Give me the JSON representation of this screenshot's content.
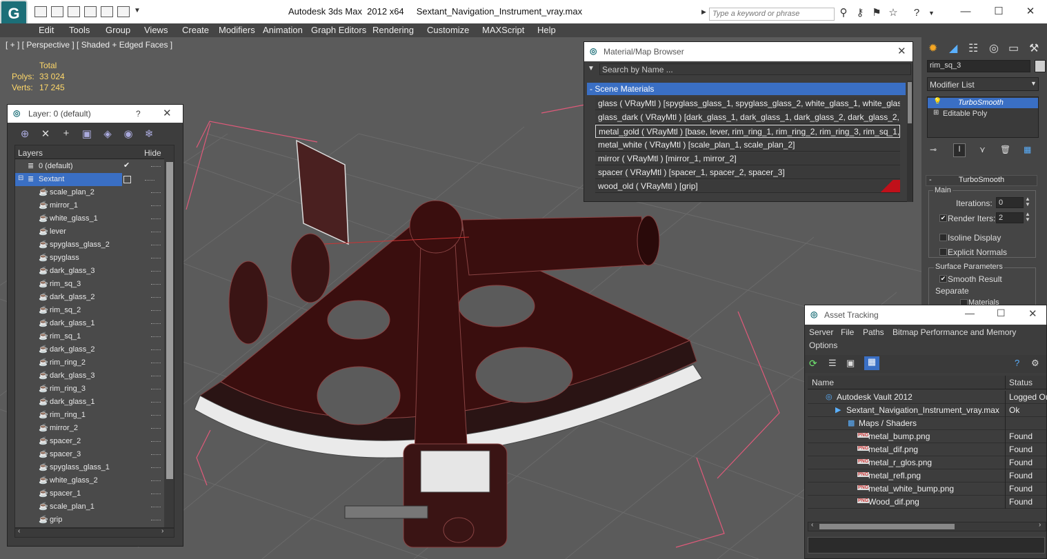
{
  "app": {
    "title": "Autodesk 3ds Max  2012 x64     Sextant_Navigation_Instrument_vray.max",
    "search_placeholder": "Type a keyword or phrase"
  },
  "menu": [
    "Edit",
    "Tools",
    "Group",
    "Views",
    "Create",
    "Modifiers",
    "Animation",
    "Graph Editors",
    "Rendering",
    "Customize",
    "MAXScript",
    "Help"
  ],
  "viewport": {
    "label": "[ + ] [ Perspective ] [ Shaded + Edged Faces ]",
    "stats": {
      "header": "Total",
      "polys_label": "Polys:",
      "polys_value": "33 024",
      "verts_label": "Verts:",
      "verts_value": "17 245"
    }
  },
  "layer_panel": {
    "title": "Layer: 0 (default)",
    "help": "?",
    "col_layers": "Layers",
    "col_hide": "Hide",
    "default_layer": "0 (default)",
    "selected_layer": "Sextant",
    "objects": [
      "scale_plan_2",
      "mirror_1",
      "white_glass_1",
      "lever",
      "spyglass_glass_2",
      "spyglass",
      "dark_glass_3",
      "rim_sq_3",
      "dark_glass_2",
      "rim_sq_2",
      "dark_glass_1",
      "rim_sq_1",
      "dark_glass_2",
      "rim_ring_2",
      "dark_glass_3",
      "rim_ring_3",
      "dark_glass_1",
      "rim_ring_1",
      "mirror_2",
      "spacer_2",
      "spacer_3",
      "spyglass_glass_1",
      "white_glass_2",
      "spacer_1",
      "scale_plan_1",
      "grip"
    ]
  },
  "material_browser": {
    "title": "Material/Map Browser",
    "search_placeholder": "Search by Name ...",
    "section": "Scene Materials",
    "materials": [
      "glass  ( VRayMtl ) [spyglass_glass_1, spyglass_glass_2, white_glass_1, white_glass_...",
      "glass_dark  ( VRayMtl ) [dark_glass_1, dark_glass_1, dark_glass_2, dark_glass_2, d...",
      "metal_gold  ( VRayMtl )  [base, lever, rim_ring_1, rim_ring_2, rim_ring_3, rim_sq_1,...",
      "metal_white  ( VRayMtl )  [scale_plan_1, scale_plan_2]",
      "mirror  ( VRayMtl )  [mirror_1, mirror_2]",
      "spacer  ( VRayMtl )  [spacer_1, spacer_2, spacer_3]",
      "wood_old  ( VRayMtl )  [grip]"
    ]
  },
  "command_panel": {
    "object_name": "rim_sq_3",
    "modifier_list": "Modifier List",
    "stack": [
      "TurboSmooth",
      "Editable Poly"
    ],
    "rollout_title": "TurboSmooth",
    "main_group": "Main",
    "iterations_label": "Iterations:",
    "iterations_value": "0",
    "render_iters_label": "Render Iters:",
    "render_iters_value": "2",
    "isoline_label": "Isoline Display",
    "explicit_normals_label": "Explicit Normals",
    "surface_params_label": "Surface Parameters",
    "smooth_result_label": "Smooth Result",
    "separate_label": "Separate",
    "materials_label": "Materials"
  },
  "asset_tracking": {
    "title": "Asset Tracking",
    "menu": [
      "Server",
      "File",
      "Paths",
      "Bitmap Performance and Memory",
      "Options"
    ],
    "col_name": "Name",
    "col_status": "Status",
    "rows": [
      {
        "name": "Autodesk Vault 2012",
        "status": "Logged Ou"
      },
      {
        "name": "Sextant_Navigation_Instrument_vray.max",
        "status": "Ok"
      },
      {
        "name": "Maps / Shaders",
        "status": ""
      },
      {
        "name": "metal_bump.png",
        "status": "Found"
      },
      {
        "name": "metal_dif.png",
        "status": "Found"
      },
      {
        "name": "metal_r_glos.png",
        "status": "Found"
      },
      {
        "name": "metal_refl.png",
        "status": "Found"
      },
      {
        "name": "metal_white_bump.png",
        "status": "Found"
      },
      {
        "name": "Wood_dif.png",
        "status": "Found"
      }
    ]
  }
}
